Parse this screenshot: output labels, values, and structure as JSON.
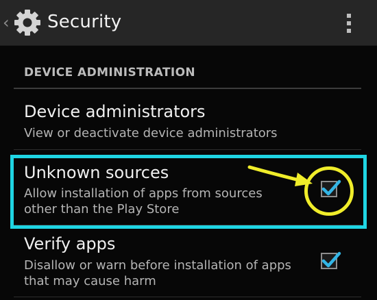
{
  "header": {
    "up_caret": "‹",
    "icon": "gear-icon",
    "title": "Security",
    "menu_icon": "overflow-menu-icon"
  },
  "section": {
    "title": "DEVICE ADMINISTRATION"
  },
  "items": [
    {
      "title": "Device administrators",
      "summary": "View or deactivate device administrators",
      "has_checkbox": false
    },
    {
      "title": "Unknown sources",
      "summary_line1": "Allow installation of apps from sources",
      "summary_line2": "other than the Play Store",
      "checked": true,
      "highlighted": true
    },
    {
      "title": "Verify apps",
      "summary_line1": "Disallow or warn before installation of apps",
      "summary_line2": "that may cause harm",
      "checked": true
    }
  ],
  "colors": {
    "accent_check": "#33b5e5",
    "highlight_box": "#1fd5e3",
    "annotation": "#f0ed2a",
    "background": "#070707",
    "actionbar": "#262626"
  }
}
